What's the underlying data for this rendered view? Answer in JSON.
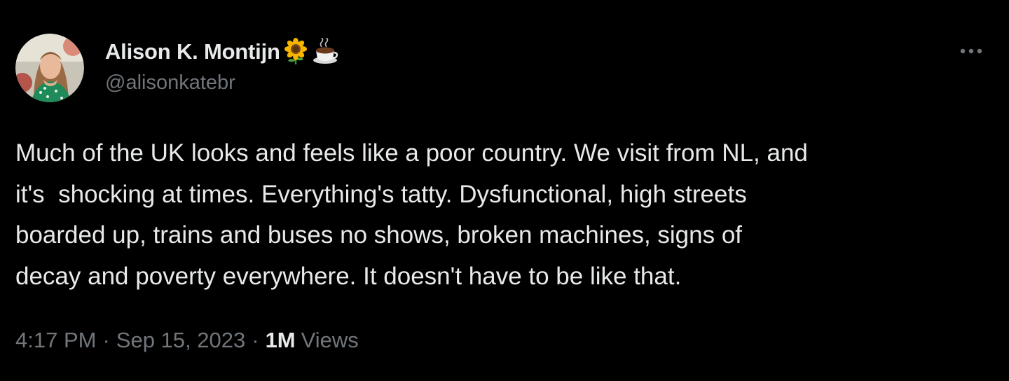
{
  "author": {
    "display_name": "Alison K. Montijn",
    "name_emojis": [
      "sunflower-icon",
      "coffee-icon"
    ],
    "handle": "@alisonkatebr"
  },
  "tweet": {
    "text_lines": [
      "Much of the UK looks and feels like a poor country. We visit from NL, and",
      "it's  shocking at times. Everything's tatty. Dysfunctional, high streets",
      "boarded up, trains and buses no shows, broken machines, signs of",
      "decay and poverty everywhere. It doesn't have to be like that."
    ]
  },
  "meta": {
    "time": "4:17 PM",
    "separator": "·",
    "date": "Sep 15, 2023",
    "views_count": "1M",
    "views_label": "Views"
  },
  "colors": {
    "background": "#000000",
    "primary_text": "#e7e9ea",
    "secondary_text": "#71767b"
  }
}
